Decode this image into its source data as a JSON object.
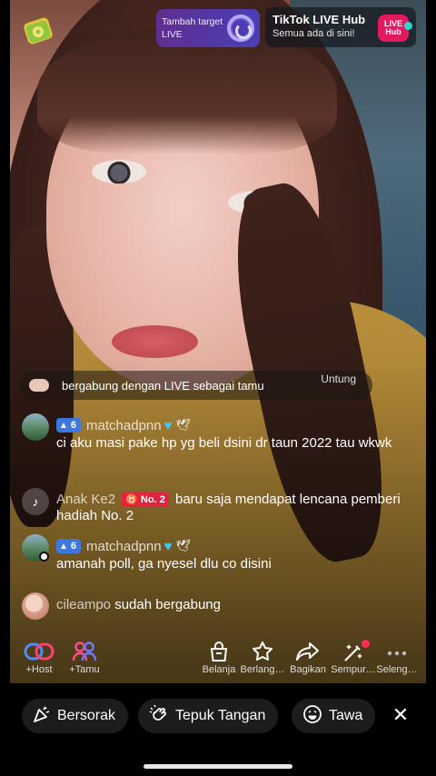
{
  "top": {
    "badge_icon": "diamond-badge-icon",
    "target": {
      "line1": "Tambah target",
      "line2": "LIVE"
    },
    "hub": {
      "title": "TikTok LIVE Hub",
      "subtitle": "Semua ada di sini!",
      "logo_line1": "LIVE",
      "logo_line2": "Hub"
    }
  },
  "chat": {
    "join_banner": "bergabung dengan LIVE sebagai tamu",
    "join_banner_extra": "Untung",
    "messages": [
      {
        "level": "6",
        "username": "matchadpnn",
        "text": "ci aku masi pake hp yg beli dsini dr taun 2022 tau wkwk"
      },
      {
        "name": "Anak Ke2",
        "badge": "No. 2",
        "text_before": "baru saja mendapat lencana",
        "text_after": "pemberi hadiah No. 2"
      },
      {
        "level": "6",
        "username": "matchadpnn",
        "text": "amanah poll, ga nyesel dlu co disini"
      },
      {
        "name": "cileampo",
        "text": "sudah bergabung"
      }
    ]
  },
  "actions": {
    "host": "+Host",
    "guest": "+Tamu",
    "shop": "Belanja",
    "subscribe": "Berlang…",
    "share": "Bagikan",
    "effects": "Sempur…",
    "more": "Seleng…"
  },
  "reactions": {
    "cheer": "Bersorak",
    "clap": "Tepuk Tangan",
    "laugh": "Tawa"
  },
  "colors": {
    "level_badge": "#3c78e0",
    "rank_badge": "#e2233d",
    "accent_heart": "#40c8f5",
    "hub_logo": "#e5195f"
  }
}
